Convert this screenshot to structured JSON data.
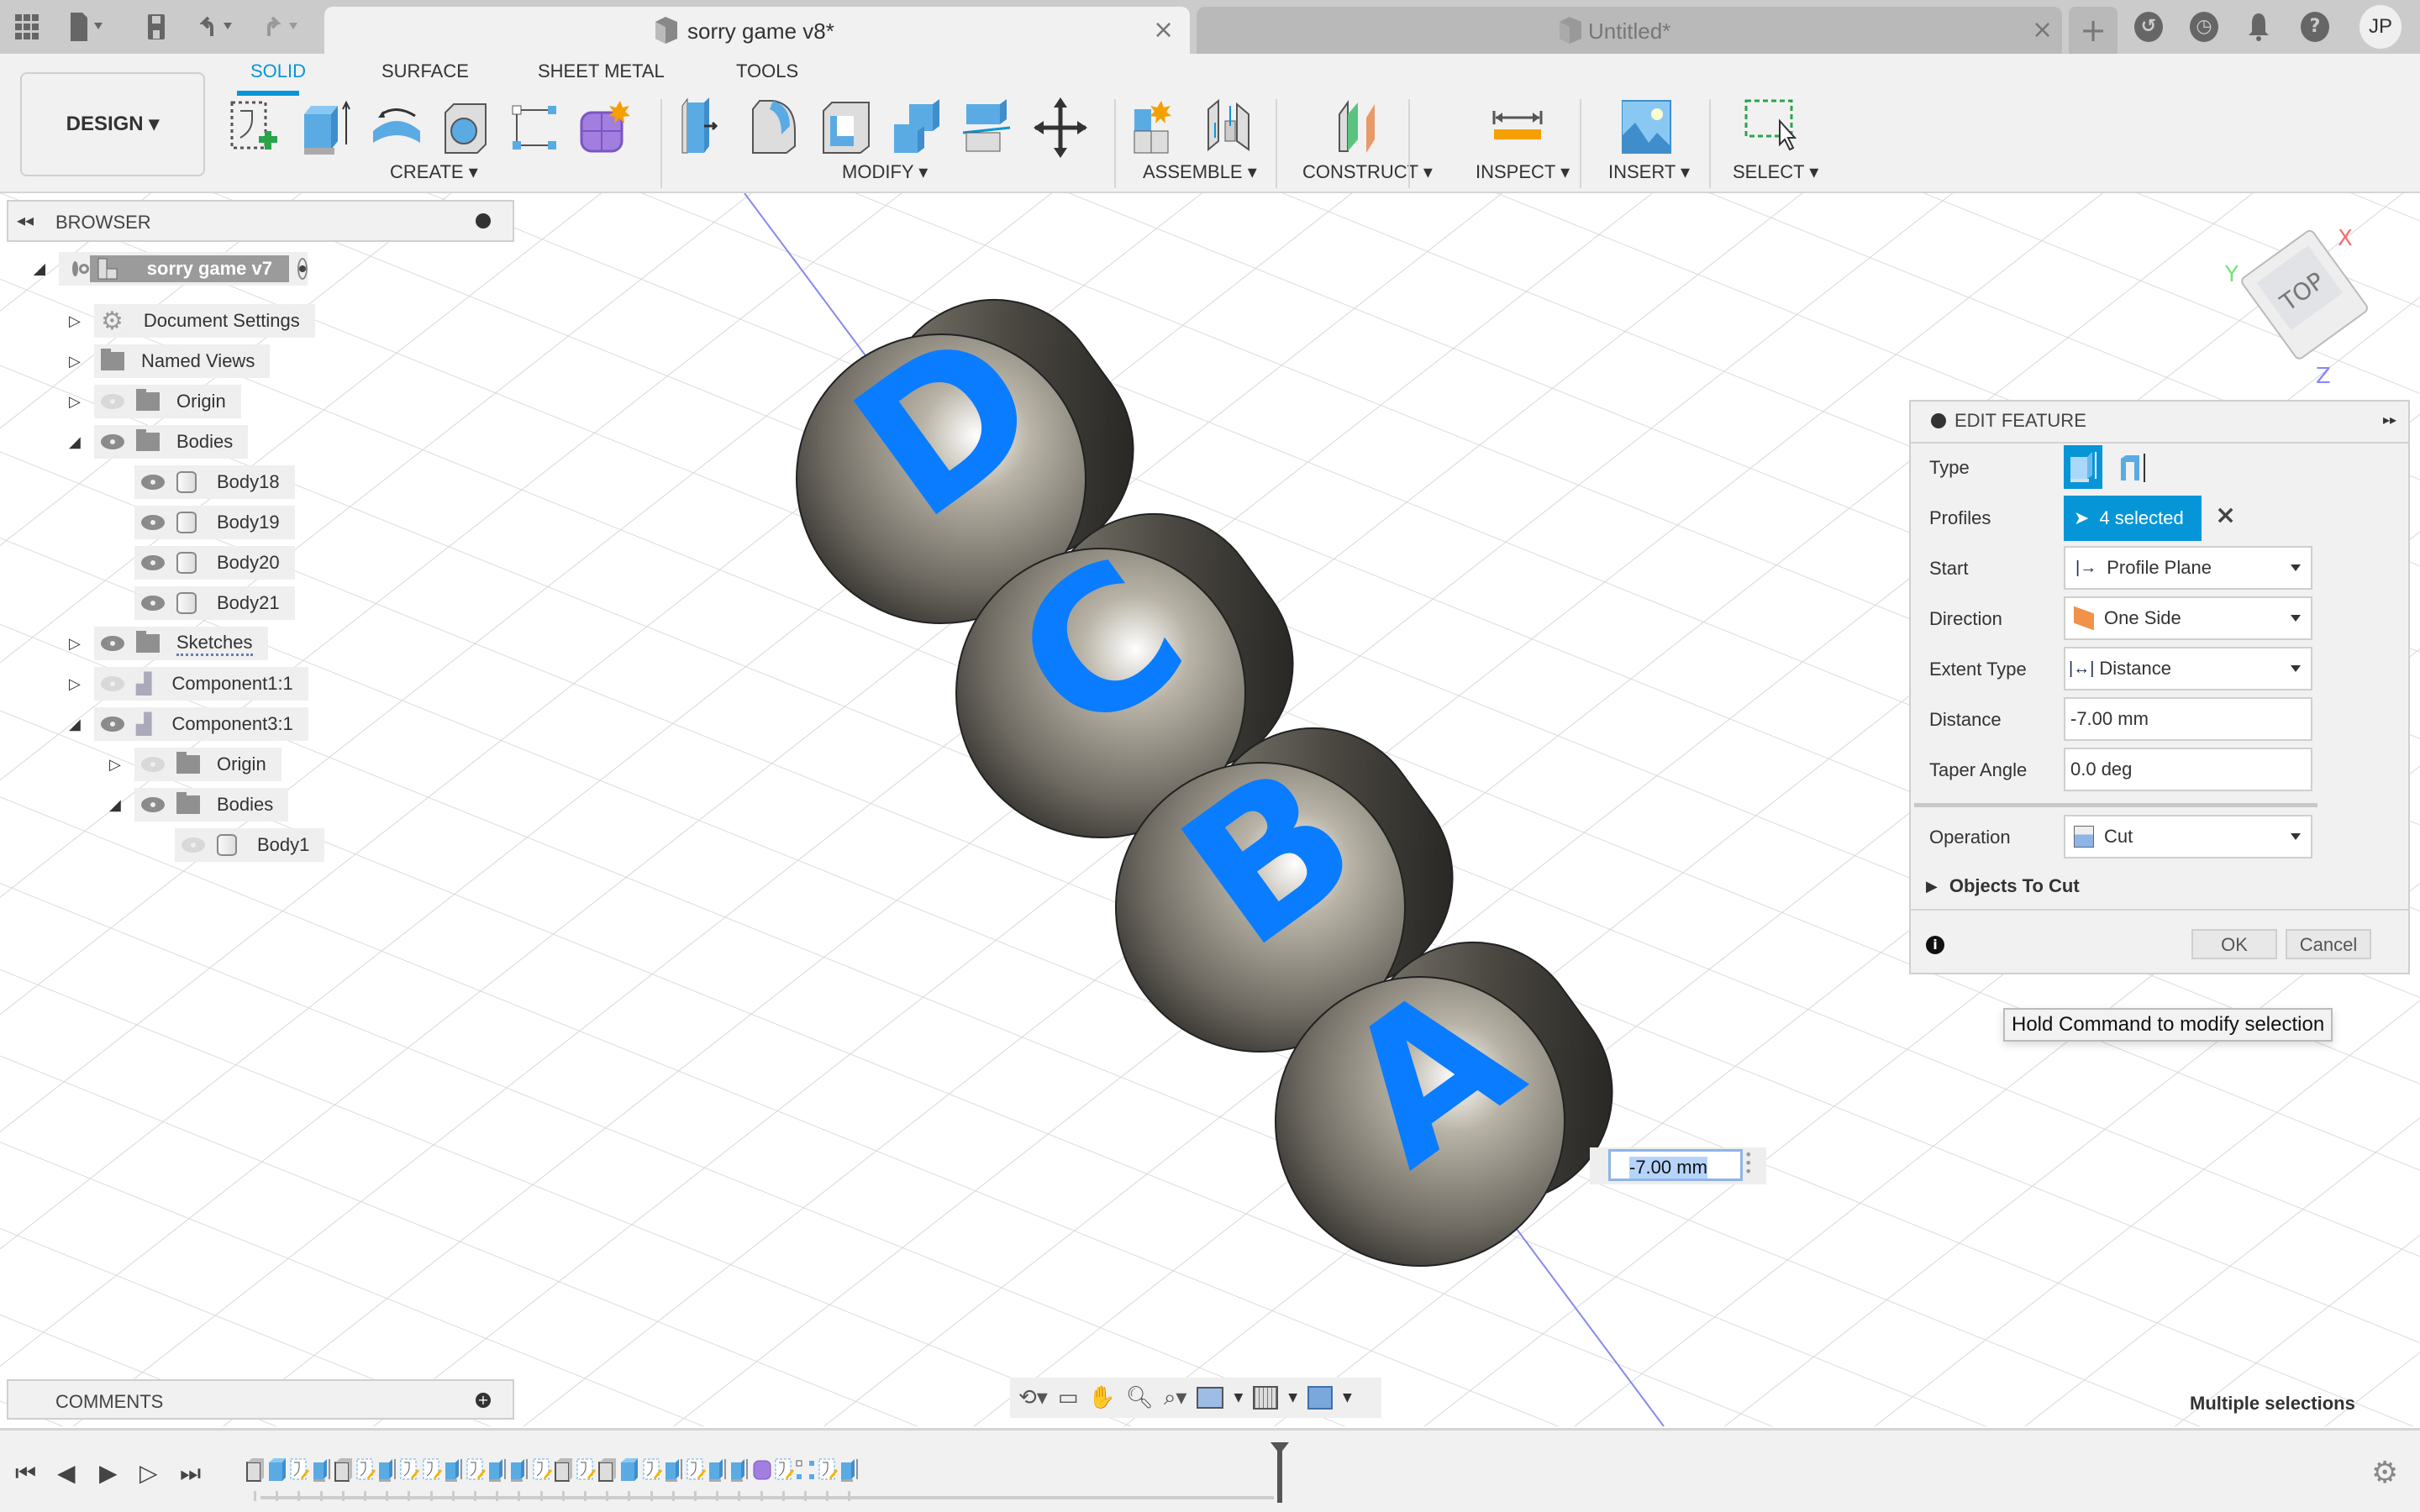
{
  "titlebar": {
    "tabs": [
      {
        "label": "sorry game v8*",
        "active": true
      },
      {
        "label": "Untitled*",
        "active": false
      }
    ],
    "icons": [
      "apps-grid-icon",
      "file-icon",
      "save-icon",
      "undo-icon",
      "redo-icon"
    ],
    "right_icons": [
      "new-tab-icon",
      "extensions-icon",
      "job-status-icon",
      "notifications-icon",
      "help-icon"
    ],
    "user_initials": "JP"
  },
  "ribbon": {
    "workspace": "DESIGN ▾",
    "tabs": [
      "SOLID",
      "SURFACE",
      "SHEET METAL",
      "TOOLS"
    ],
    "active_tab": "SOLID",
    "groups": [
      {
        "label": "CREATE ▾",
        "tools": [
          "create-sketch",
          "extrude",
          "revolve",
          "hole",
          "pattern",
          "create-form"
        ]
      },
      {
        "label": "MODIFY ▾",
        "tools": [
          "press-pull",
          "fillet",
          "shell",
          "combine",
          "split-body",
          "move-copy"
        ]
      },
      {
        "label": "ASSEMBLE ▾",
        "tools": [
          "new-component",
          "joint"
        ]
      },
      {
        "label": "CONSTRUCT ▾",
        "tools": [
          "offset-plane"
        ]
      },
      {
        "label": "INSPECT ▾",
        "tools": [
          "measure"
        ]
      },
      {
        "label": "INSERT ▾",
        "tools": [
          "insert-image"
        ]
      },
      {
        "label": "SELECT ▾",
        "tools": [
          "window-select"
        ]
      }
    ]
  },
  "browser": {
    "title": "BROWSER",
    "root": "sorry game v7",
    "items": [
      {
        "label": "Document Settings",
        "level": 1,
        "expander": "closed",
        "icon": "gear",
        "eye": "none"
      },
      {
        "label": "Named Views",
        "level": 1,
        "expander": "closed",
        "icon": "folder",
        "eye": "none"
      },
      {
        "label": "Origin",
        "level": 1,
        "expander": "closed",
        "icon": "folder",
        "eye": "hidden"
      },
      {
        "label": "Bodies",
        "level": 1,
        "expander": "open",
        "icon": "folder",
        "eye": "visible"
      },
      {
        "label": "Body18",
        "level": 2,
        "expander": "none",
        "icon": "body",
        "eye": "visible"
      },
      {
        "label": "Body19",
        "level": 2,
        "expander": "none",
        "icon": "body",
        "eye": "visible"
      },
      {
        "label": "Body20",
        "level": 2,
        "expander": "none",
        "icon": "body",
        "eye": "visible"
      },
      {
        "label": "Body21",
        "level": 2,
        "expander": "none",
        "icon": "body",
        "eye": "visible"
      },
      {
        "label": "Sketches",
        "level": 1,
        "expander": "closed",
        "icon": "folder",
        "eye": "visible"
      },
      {
        "label": "Component1:1",
        "level": 1,
        "expander": "closed",
        "icon": "component",
        "eye": "hidden"
      },
      {
        "label": "Component3:1",
        "level": 1,
        "expander": "open",
        "icon": "component",
        "eye": "visible"
      },
      {
        "label": "Origin",
        "level": 2,
        "expander": "closed",
        "icon": "folder",
        "eye": "hidden"
      },
      {
        "label": "Bodies",
        "level": 2,
        "expander": "open",
        "icon": "folder",
        "eye": "visible"
      },
      {
        "label": "Body1",
        "level": 3,
        "expander": "none",
        "icon": "body",
        "eye": "hidden"
      }
    ]
  },
  "comments": {
    "title": "COMMENTS"
  },
  "viewcube": {
    "face": "TOP",
    "axes": {
      "x": "X",
      "y": "Y",
      "z": "Z"
    }
  },
  "model": {
    "letters": [
      "D",
      "C",
      "B",
      "A"
    ],
    "letter_color": "#0a7cff"
  },
  "dimension_input": {
    "value": "-7.00 mm"
  },
  "edit_feature": {
    "title": "EDIT FEATURE",
    "type_label": "Type",
    "profiles_label": "Profiles",
    "profiles_value": "4 selected",
    "start_label": "Start",
    "start_value": "Profile Plane",
    "direction_label": "Direction",
    "direction_value": "One Side",
    "extent_label": "Extent Type",
    "extent_value": "Distance",
    "distance_label": "Distance",
    "distance_value": "-7.00 mm",
    "taper_label": "Taper Angle",
    "taper_value": "0.0 deg",
    "operation_label": "Operation",
    "operation_value": "Cut",
    "objects_to_cut": "Objects To Cut",
    "ok": "OK",
    "cancel": "Cancel"
  },
  "tooltip": "Hold Command to modify selection",
  "status": "Multiple selections",
  "nav_toolbar": [
    "orbit-icon",
    "look-at-icon",
    "pan-icon",
    "zoom-icon",
    "fit-icon",
    "display-settings-icon",
    "grid-icon",
    "viewports-icon"
  ],
  "timeline": {
    "controls": [
      "first",
      "previous",
      "play",
      "next",
      "last"
    ],
    "items": [
      "body",
      "extrude-body",
      "sketch",
      "extrude",
      "body",
      "sketch",
      "extrude",
      "sketch",
      "sketch",
      "extrude",
      "sketch",
      "extrude",
      "extrude",
      "sketch",
      "body",
      "sketch",
      "body",
      "extrude-body",
      "sketch",
      "extrude",
      "sketch",
      "extrude",
      "extrude",
      "form",
      "sketch",
      "pattern",
      "sketch",
      "extrude"
    ]
  },
  "colors": {
    "accent": "#0696d7",
    "letters": "#0a7cff"
  }
}
